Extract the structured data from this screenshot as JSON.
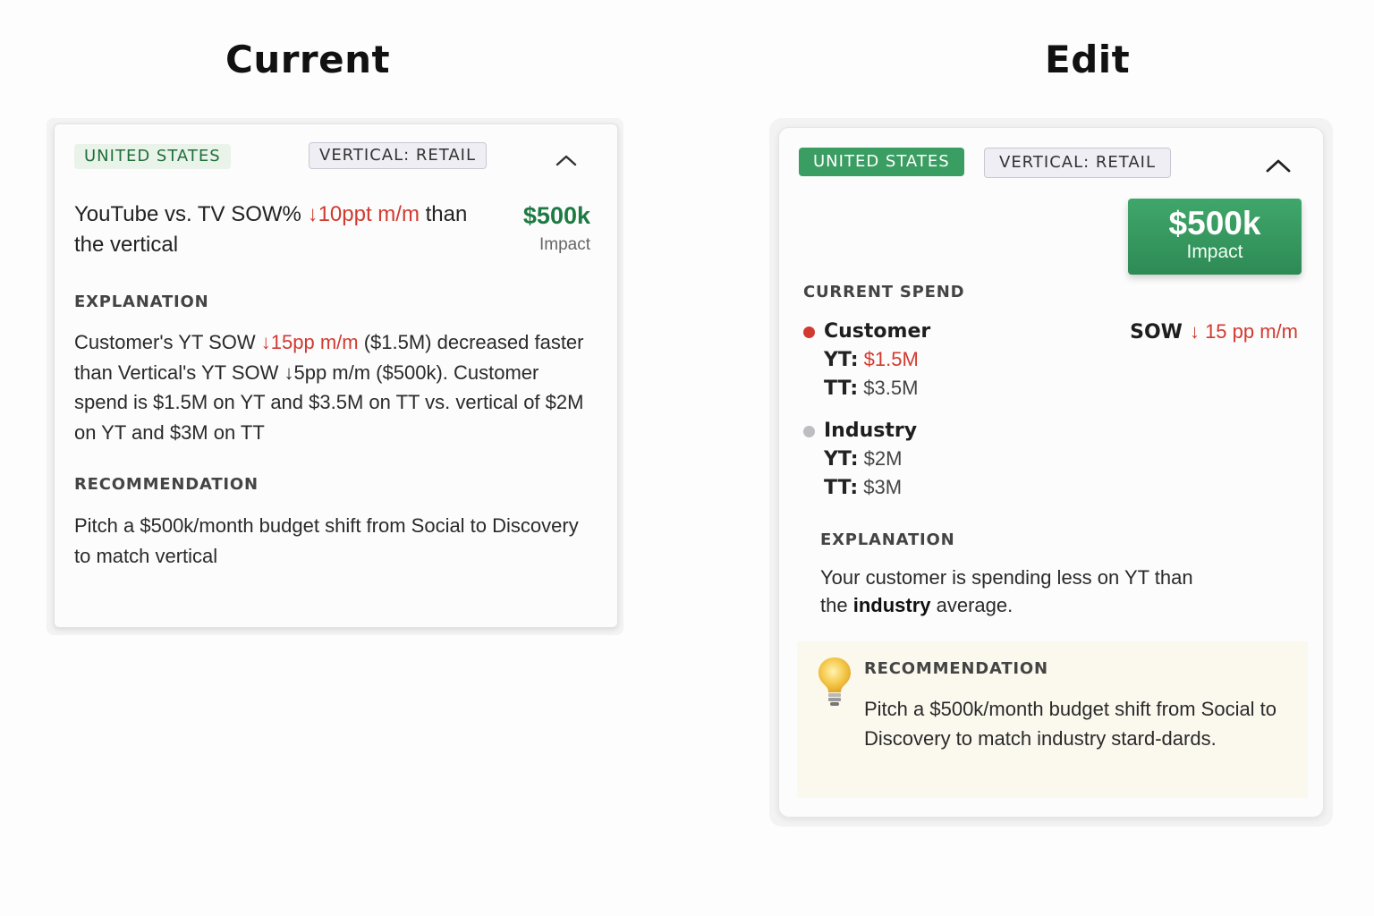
{
  "headings": {
    "current": "Current",
    "edit": "Edit"
  },
  "current_card": {
    "country_chip": "UNITED STATES",
    "vertical_chip": "VERTICAL: RETAIL",
    "collapse_icon": "chevron-up-icon",
    "headline_prefix": "YouTube vs. TV SOW% ",
    "headline_change": "↓10ppt m/m",
    "headline_suffix": " than the vertical",
    "impact_value": "$500k",
    "impact_label": "Impact",
    "explanation_label": "EXPLANATION",
    "explanation_prefix": "Customer's YT SOW ",
    "explanation_change": "↓15pp m/m",
    "explanation_suffix": " ($1.5M) decreased faster than Vertical's YT SOW ↓5pp m/m ($500k). Customer spend is $1.5M on YT and $3.5M on TT vs. vertical of $2M on YT and $3M on TT",
    "recommendation_label": "RECOMMENDATION",
    "recommendation_text": "Pitch a $500k/month budget shift from Social to Discovery to match vertical"
  },
  "edit_card": {
    "country_chip": "UNITED STATES",
    "vertical_chip": "VERTICAL: RETAIL",
    "collapse_icon": "chevron-up-icon",
    "impact_value": "$500k",
    "impact_label": "Impact",
    "current_spend_label": "CURRENT SPEND",
    "customer": {
      "name": "Customer",
      "yt_label": "YT:",
      "yt_value": "$1.5M",
      "tt_label": "TT:",
      "tt_value": "$3.5M"
    },
    "industry": {
      "name": "Industry",
      "yt_label": "YT:",
      "yt_value": "$2M",
      "tt_label": "TT:",
      "tt_value": "$3M"
    },
    "sow_label": "SOW",
    "sow_change": "↓ 15 pp m/m",
    "explanation_label": "EXPLANATION",
    "explanation_prefix": "Your customer is spending less on YT than the ",
    "explanation_bold": "industry",
    "explanation_suffix": " average.",
    "recommendation_label": "RECOMMENDATION",
    "recommendation_icon": "lightbulb-icon",
    "recommendation_text": "Pitch a $500k/month budget shift from Social to Discovery to match industry stard-dards."
  },
  "colors": {
    "accent_green": "#3a9e63",
    "impact_green_text": "#1e7a43",
    "negative_red": "#d23a30",
    "chip_vertical_bg": "#eeeef4",
    "recommendation_bg": "#fbf8ee"
  }
}
